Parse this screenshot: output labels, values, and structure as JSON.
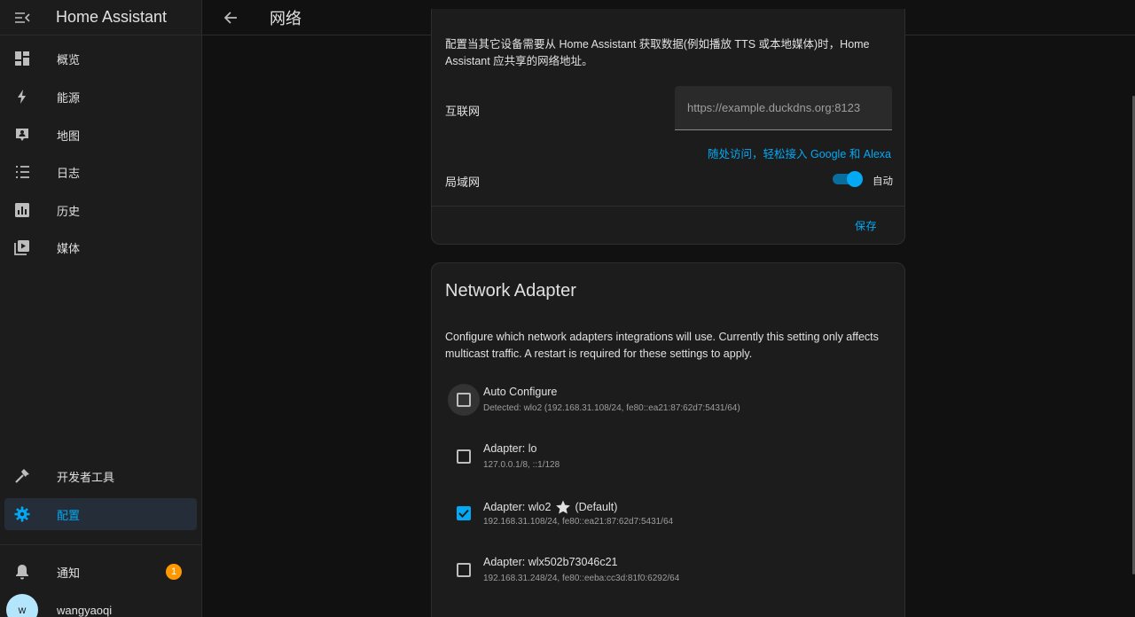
{
  "app": {
    "title": "Home Assistant"
  },
  "sidebar": {
    "items": [
      {
        "label": "概览",
        "icon": "dashboard-icon"
      },
      {
        "label": "能源",
        "icon": "lightning-icon"
      },
      {
        "label": "地图",
        "icon": "map-icon"
      },
      {
        "label": "日志",
        "icon": "logbook-icon"
      },
      {
        "label": "历史",
        "icon": "history-chart-icon"
      },
      {
        "label": "媒体",
        "icon": "media-play-icon"
      }
    ],
    "developer_tools": "开发者工具",
    "config": "配置",
    "notifications": {
      "label": "通知",
      "count": "1"
    },
    "user": {
      "name": "wangyaoqi",
      "initial": "w"
    }
  },
  "header": {
    "title": "网络"
  },
  "url_card": {
    "description": "配置当其它设备需要从 Home Assistant 获取数据(例如播放 TTS 或本地媒体)时，Home Assistant 应共享的网络地址。",
    "internet_label": "互联网",
    "internet_placeholder": "https://example.duckdns.org:8123",
    "remote_link": "随处访问，轻松接入 Google 和 Alexa",
    "local_label": "局域网",
    "auto_label": "自动",
    "auto_enabled": true,
    "save_label": "保存"
  },
  "adapter_card": {
    "title": "Network Adapter",
    "description": "Configure which network adapters integrations will use. Currently this setting only affects multicast traffic. A restart is required for these settings to apply.",
    "adapters": [
      {
        "name": "Auto Configure",
        "default_tag": "",
        "detail": "Detected: wlo2 (192.168.31.108/24, fe80::ea21:87:62d7:5431/64)",
        "checked": false
      },
      {
        "name": "Adapter: lo",
        "default_tag": "",
        "detail": "127.0.0.1/8, ::1/128",
        "checked": false
      },
      {
        "name": "Adapter: wlo2",
        "default_tag": "(Default)",
        "detail": "192.168.31.108/24, fe80::ea21:87:62d7:5431/64",
        "checked": true
      },
      {
        "name": "Adapter: wlx502b73046c21",
        "default_tag": "",
        "detail": "192.168.31.248/24, fe80::eeba:cc3d:81f0:6292/64",
        "checked": false
      }
    ]
  },
  "colors": {
    "accent": "#03a9f4",
    "badge": "#ff9800",
    "background": "#111111",
    "card": "#1c1c1c"
  }
}
